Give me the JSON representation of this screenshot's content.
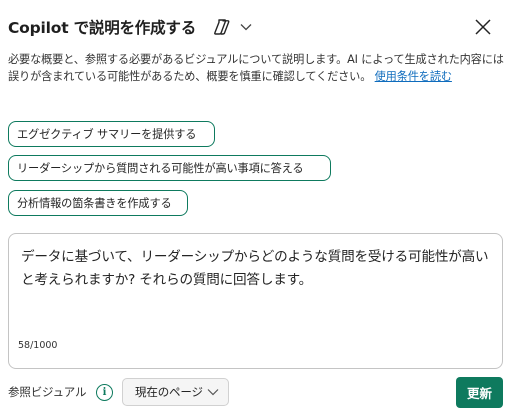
{
  "header": {
    "title": "Copilot で説明を作成する"
  },
  "description": {
    "text": "必要な概要と、参照する必要があるビジュアルについて説明します。AI によって生成された内容には誤りが含まれている可能性があるため、概要を慎重に確認してください。",
    "link": "使用条件を読む"
  },
  "suggestions": [
    "エグゼクティブ サマリーを提供する",
    "リーダーシップから質問される可能性が高い事項に答える",
    "分析情報の箇条書きを作成する"
  ],
  "prompt": {
    "text": "データに基づいて、リーダーシップからどのような質問を受ける可能性が高いと考えられますか? それらの質問に回答します。",
    "counter": "58/1000"
  },
  "footer": {
    "label": "参照ビジュアル",
    "dropdown_value": "現在のページ",
    "update_button": "更新"
  },
  "colors": {
    "accent": "#0e7a5e",
    "link": "#0f6cbd"
  },
  "icons": [
    "copilot-icon",
    "chevron-down-icon",
    "close-icon",
    "info-icon"
  ]
}
